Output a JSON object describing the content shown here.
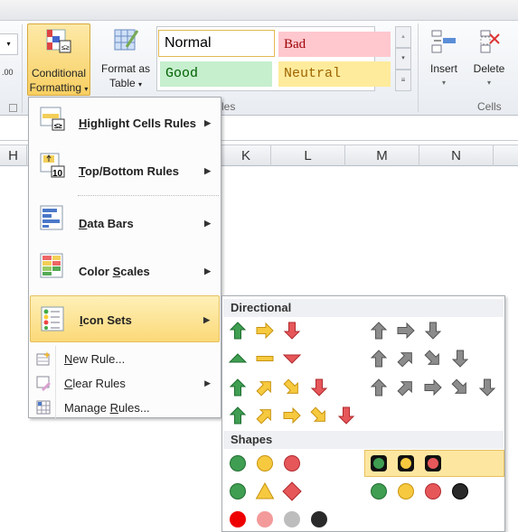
{
  "ribbon": {
    "conditional_formatting": [
      "Conditional",
      "Formatting"
    ],
    "format_as_table": [
      "Format as",
      "Table"
    ],
    "styles": {
      "normal": "Normal",
      "bad": "Bad",
      "good": "Good",
      "neutral": "Neutral",
      "group_label_fragment": "les"
    },
    "insert": "Insert",
    "delete": "Delete",
    "cells_group": "Cells",
    "number_fragment": ".00"
  },
  "columns": [
    "H",
    "K",
    "L",
    "M",
    "N"
  ],
  "menu": {
    "items": [
      {
        "label": "Highlight Cells Rules",
        "key": "H",
        "rest": "ighlight Cells Rules"
      },
      {
        "label": "Top/Bottom Rules",
        "key": "T",
        "rest": "op/Bottom Rules"
      },
      {
        "label": "Data Bars",
        "key": "D",
        "rest": "ata Bars"
      },
      {
        "label": "Color Scales",
        "key": "S",
        "pre": "Color ",
        "rest": "cales"
      },
      {
        "label": "Icon Sets",
        "key": "I",
        "rest": "con Sets"
      }
    ],
    "small_items": [
      {
        "label": "New Rule...",
        "pre": "",
        "key": "N",
        "rest": "ew Rule..."
      },
      {
        "label": "Clear Rules",
        "pre": "",
        "key": "C",
        "rest": "lear Rules"
      },
      {
        "label": "Manage Rules...",
        "pre": "Manage ",
        "key": "R",
        "rest": "ules..."
      }
    ]
  },
  "submenu": {
    "directional_header": "Directional",
    "shapes_header": "Shapes",
    "directional_left": [
      [
        [
          "up",
          "green"
        ],
        [
          "right",
          "yellow"
        ],
        [
          "down",
          "red"
        ]
      ],
      [
        [
          "tri-up",
          "green"
        ],
        [
          "dash",
          "yellow"
        ],
        [
          "tri-down",
          "red"
        ]
      ],
      [
        [
          "up",
          "green"
        ],
        [
          "up-right",
          "yellow"
        ],
        [
          "down-right",
          "yellow"
        ],
        [
          "down",
          "red"
        ]
      ],
      [
        [
          "up",
          "green"
        ],
        [
          "up-right",
          "yellow"
        ],
        [
          "right",
          "yellow"
        ],
        [
          "down-right",
          "yellow"
        ],
        [
          "down",
          "red"
        ]
      ]
    ],
    "directional_right": [
      [
        [
          "up",
          "gray"
        ],
        [
          "right",
          "gray"
        ],
        [
          "down",
          "gray"
        ]
      ],
      [
        [
          "up",
          "gray"
        ],
        [
          "up-right",
          "gray"
        ],
        [
          "down-right",
          "gray"
        ],
        [
          "down",
          "gray"
        ]
      ],
      [
        [
          "up",
          "gray"
        ],
        [
          "up-right",
          "gray"
        ],
        [
          "right",
          "gray"
        ],
        [
          "down-right",
          "gray"
        ],
        [
          "down",
          "gray"
        ]
      ]
    ],
    "shapes_left": [
      [
        [
          "circle",
          "green"
        ],
        [
          "circle",
          "yellow"
        ],
        [
          "circle",
          "red"
        ]
      ],
      [
        [
          "circle",
          "green"
        ],
        [
          "triangle",
          "yellow"
        ],
        [
          "diamond",
          "red"
        ]
      ],
      [
        [
          "flat-circle",
          "brightred"
        ],
        [
          "flat-circle",
          "pink"
        ],
        [
          "flat-circle",
          "silver"
        ],
        [
          "flat-circle",
          "black"
        ]
      ]
    ],
    "shapes_right": [
      [
        [
          "light",
          "green"
        ],
        [
          "light",
          "yellow"
        ],
        [
          "light",
          "red"
        ]
      ],
      [
        [
          "circle",
          "green"
        ],
        [
          "circle",
          "yellow"
        ],
        [
          "circle",
          "red"
        ],
        [
          "circle",
          "black"
        ]
      ]
    ],
    "highlighted": "traffic-lights-rimmed"
  },
  "colors": {
    "green": "#3f9e52",
    "yellow": "#f6c93f",
    "red": "#e6575a",
    "gray": "#8c8c8c",
    "black": "#2a2a2a",
    "brightred": "#ee0000",
    "pink": "#f39a9a",
    "silver": "#bdbdbd",
    "hover": "#fde7a0"
  }
}
